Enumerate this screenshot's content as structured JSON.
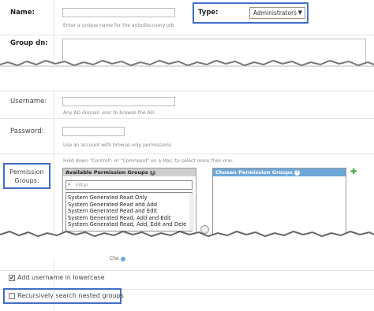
{
  "form": {
    "name_label": "Name:",
    "name_value": "",
    "name_hint": "Enter a unique name for the autodiscovery job",
    "type_label": "Type:",
    "type_value": "Administrators",
    "group_dn_label": "Group dn:",
    "username_label": "Username:",
    "username_hint": "Any AD domain user to browse the AD",
    "password_label": "Password:",
    "password_hint": "Use an account with browse only permissions",
    "multi_select_hint": "Hold down \"Control\", or \"Command\" on a Mac, to select more then one.",
    "permission_groups_label": "Permission Groups:",
    "available_groups_title": "Available Permission Groups",
    "filter_placeholder": "Filter",
    "available_groups": [
      "System Generated Read Only",
      "System Generated Read and Add",
      "System Generated Read and Edit",
      "System Generated Read, Add and Edit",
      "System Generated Read, Add, Edit and Dele"
    ],
    "chosen_groups_title": "Chosen Permission Groups",
    "partial_label": "Cho",
    "lowercase_label": "Add username in lowercase",
    "lowercase_checked": true,
    "nested_label": "Recursively search nested groups",
    "nested_checked": false
  },
  "colors": {
    "highlight": "#3f6fc6",
    "available_header_bg": "#cfcfcf",
    "chosen_header_bg": "#6fa7d9",
    "add_icon": "#3ba03b"
  },
  "icons": {
    "help": "help-icon",
    "search": "search-icon",
    "add": "add-icon",
    "dropdown": "dropdown-arrow-icon"
  }
}
